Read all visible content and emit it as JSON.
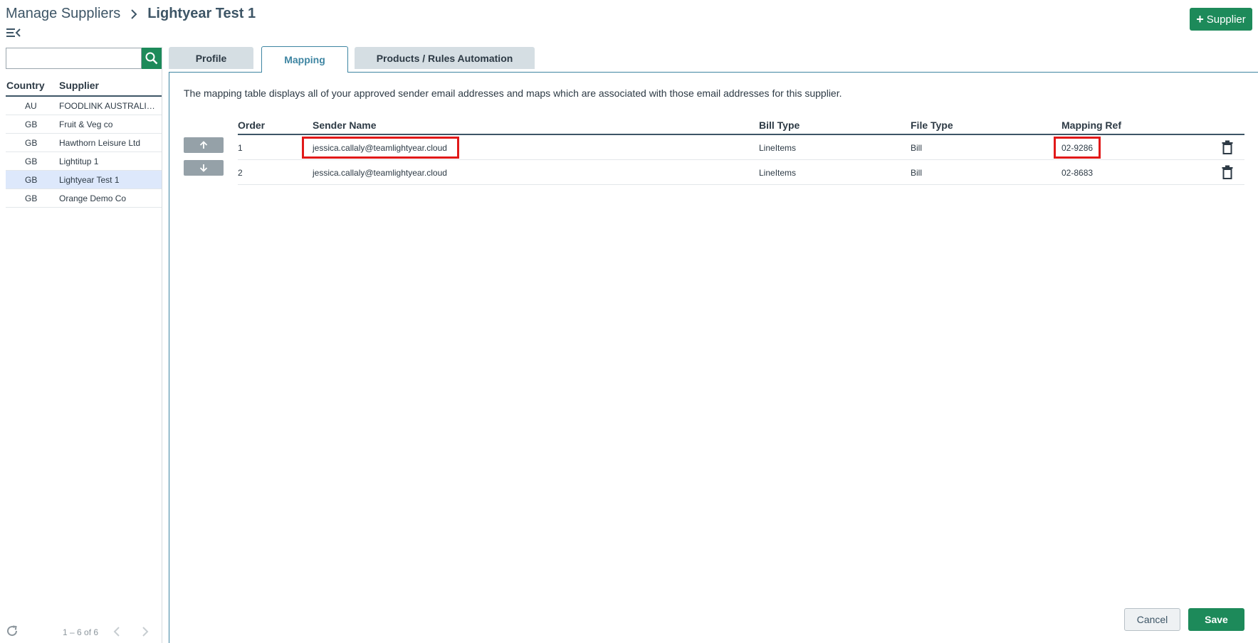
{
  "header": {
    "breadcrumb_root": "Manage Suppliers",
    "breadcrumb_current": "Lightyear Test 1",
    "add_supplier_label": "Supplier"
  },
  "sidebar": {
    "search_placeholder": "",
    "columns": {
      "country": "Country",
      "supplier": "Supplier"
    },
    "suppliers": [
      {
        "country": "AU",
        "name": "FOODLINK AUSTRALIA PTY LTD",
        "selected": false
      },
      {
        "country": "GB",
        "name": "Fruit & Veg co",
        "selected": false
      },
      {
        "country": "GB",
        "name": "Hawthorn Leisure Ltd",
        "selected": false
      },
      {
        "country": "GB",
        "name": "Lightitup 1",
        "selected": false
      },
      {
        "country": "GB",
        "name": "Lightyear Test 1",
        "selected": true
      },
      {
        "country": "GB",
        "name": "Orange Demo Co",
        "selected": false
      }
    ],
    "pager_text": "1 – 6 of 6"
  },
  "tabs": [
    {
      "label": "Profile",
      "active": false
    },
    {
      "label": "Mapping",
      "active": true
    },
    {
      "label": "Products / Rules Automation",
      "active": false
    }
  ],
  "mapping": {
    "description": "The mapping table displays all of your approved sender email addresses and maps which are associated with those email addresses for this supplier.",
    "columns": {
      "order": "Order",
      "sender_name": "Sender Name",
      "bill_type": "Bill Type",
      "file_type": "File Type",
      "mapping_ref": "Mapping Ref"
    },
    "rows": [
      {
        "order": "1",
        "sender_name": "jessica.callaly@teamlightyear.cloud",
        "bill_type": "LineItems",
        "file_type": "Bill",
        "mapping_ref": "02-9286",
        "highlighted": true
      },
      {
        "order": "2",
        "sender_name": "jessica.callaly@teamlightyear.cloud",
        "bill_type": "LineItems",
        "file_type": "Bill",
        "mapping_ref": "02-8683",
        "highlighted": false
      }
    ]
  },
  "footer": {
    "cancel_label": "Cancel",
    "save_label": "Save"
  },
  "colors": {
    "brand_green": "#1d8a5a",
    "tab_active": "#3e85a2",
    "selected_row": "#dde8fb",
    "highlight_red": "#e11919"
  },
  "icons": {
    "search": "search-icon",
    "menu": "menu-collapse-icon",
    "delete": "trash-icon",
    "refresh": "refresh-icon"
  }
}
